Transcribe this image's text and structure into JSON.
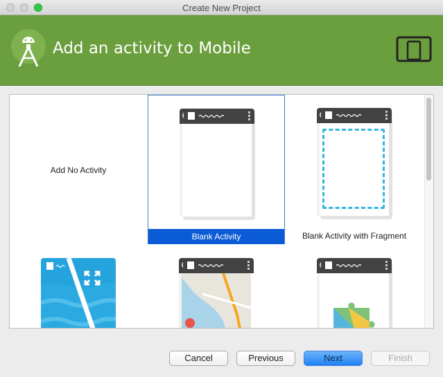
{
  "window": {
    "title": "Create New Project"
  },
  "banner": {
    "title": "Add an activity to Mobile",
    "logo_icon": "android-studio-logo-icon",
    "device_icon": "phone-tablet-icon"
  },
  "templates": [
    {
      "label": "Add No Activity",
      "selected": false
    },
    {
      "label": "Blank Activity",
      "selected": true
    },
    {
      "label": "Blank Activity with Fragment",
      "selected": false
    },
    {
      "label": "",
      "selected": false
    },
    {
      "label": "",
      "selected": false
    },
    {
      "label": "",
      "selected": false
    }
  ],
  "buttons": {
    "cancel": "Cancel",
    "previous": "Previous",
    "next": "Next",
    "finish": "Finish"
  },
  "colors": {
    "banner": "#6b9e3d",
    "selection": "#0b5bd7",
    "primary_button": "#2b8af5"
  }
}
